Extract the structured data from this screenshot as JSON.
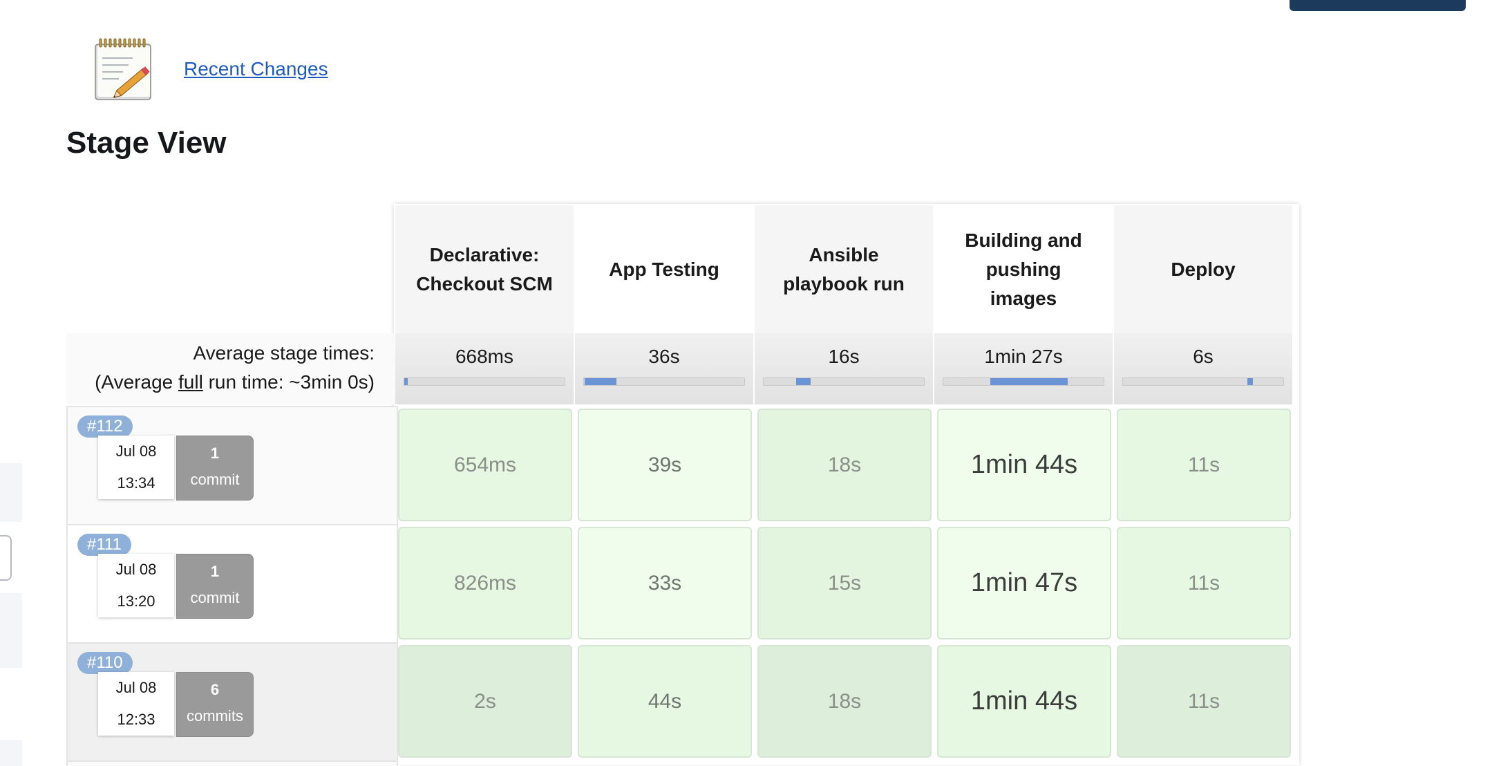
{
  "recent_changes": {
    "label": "Recent Changes",
    "icon": "notepad-pencil-icon"
  },
  "stage_view": {
    "title": "Stage View",
    "stages": [
      "Declarative: Checkout SCM",
      "App Testing",
      "Ansible playbook run",
      "Building and pushing images",
      "Deploy"
    ],
    "average": {
      "label": "Average stage times:",
      "full_prefix": "(Average ",
      "full_word": "full",
      "full_suffix": " run time: ~3min 0s)",
      "times": [
        "668ms",
        "36s",
        "16s",
        "1min 27s",
        "6s"
      ],
      "progress": [
        {
          "start": 0.0,
          "end": 0.004
        },
        {
          "start": 0.004,
          "end": 0.204
        },
        {
          "start": 0.204,
          "end": 0.293
        },
        {
          "start": 0.293,
          "end": 0.776
        },
        {
          "start": 0.776,
          "end": 0.81
        }
      ]
    },
    "builds": [
      {
        "number": "#112",
        "date": "Jul 08",
        "time": "13:34",
        "commit_count": "1",
        "commit_label": "commit",
        "stage_times": [
          "654ms",
          "39s",
          "18s",
          "1min 44s",
          "11s"
        ]
      },
      {
        "number": "#111",
        "date": "Jul 08",
        "time": "13:20",
        "commit_count": "1",
        "commit_label": "commit",
        "stage_times": [
          "826ms",
          "33s",
          "15s",
          "1min 47s",
          "11s"
        ]
      },
      {
        "number": "#110",
        "date": "Jul 08",
        "time": "12:33",
        "commit_count": "6",
        "commit_label": "commits",
        "stage_times": [
          "2s",
          "44s",
          "18s",
          "1min 44s",
          "11s"
        ]
      }
    ]
  },
  "colors": {
    "link": "#1f5bbf",
    "badge": "#8fb0d8",
    "success_cell": "#e6f7e2",
    "progress_fill": "#6b94d6",
    "commit_box": "#9a9a9a"
  }
}
